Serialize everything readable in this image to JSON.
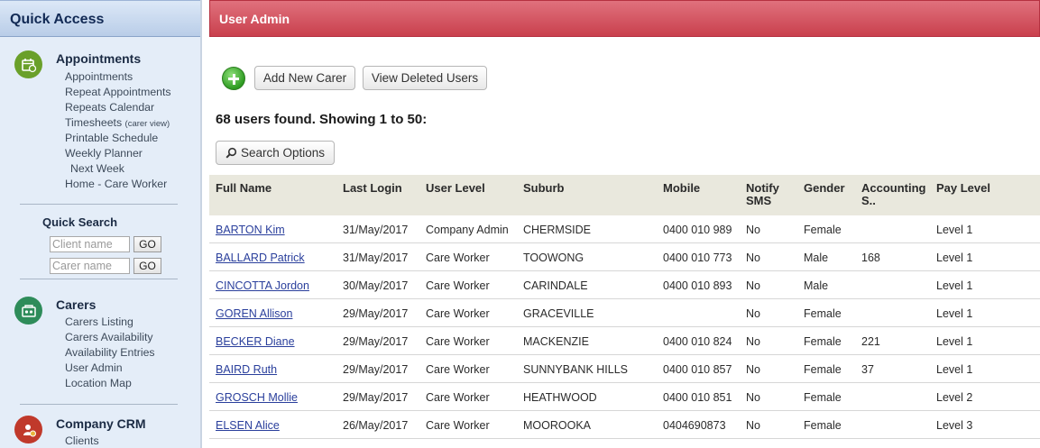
{
  "sidebar": {
    "title": "Quick Access",
    "sections": [
      {
        "title": "Appointments",
        "icon": "calendar-icon",
        "icon_color": "#6aa02a",
        "links": [
          "Appointments",
          "Repeat Appointments",
          "Repeats Calendar",
          "Timesheets",
          "Printable Schedule",
          "Weekly Planner",
          "Next Week",
          "Home - Care Worker"
        ],
        "timesheets_note": "(carer view)"
      },
      {
        "title": "Carers",
        "icon": "carers-icon",
        "icon_color": "#2e8c5a",
        "links": [
          "Carers Listing",
          "Carers Availability",
          "Availability Entries",
          "User Admin",
          "Location Map"
        ]
      },
      {
        "title": "Company CRM",
        "icon": "crm-icon",
        "icon_color": "#c0392b",
        "links": [
          "Clients"
        ]
      }
    ],
    "quick_search": {
      "title": "Quick Search",
      "client_placeholder": "Client name",
      "carer_placeholder": "Carer name",
      "go_label": "GO"
    }
  },
  "main": {
    "title": "User Admin",
    "header_color": "#cf4a57",
    "toolbar": {
      "add_icon": "plus-circle-icon",
      "add_carer_label": "Add New Carer",
      "view_deleted_label": "View Deleted Users",
      "search_options_label": "Search Options",
      "search_icon": "magnifier-icon"
    },
    "result_summary": "68 users found. Showing 1 to 50:",
    "table": {
      "columns": [
        "Full Name",
        "Last Login",
        "User Level",
        "Suburb",
        "Mobile",
        "Notify\nSMS",
        "Gender",
        "Accounting\nS..",
        "Pay Level"
      ],
      "rows": [
        [
          "BARTON Kim",
          "31/May/2017",
          "Company Admin",
          "CHERMSIDE",
          "0400 010 989",
          "No",
          "Female",
          "",
          "Level 1"
        ],
        [
          "BALLARD Patrick",
          "31/May/2017",
          "Care Worker",
          "TOOWONG",
          "0400 010 773",
          "No",
          "Male",
          "168",
          "Level 1"
        ],
        [
          "CINCOTTA Jordon",
          "30/May/2017",
          "Care Worker",
          "CARINDALE",
          "0400 010 893",
          "No",
          "Male",
          "",
          "Level 1"
        ],
        [
          "GOREN Allison",
          "29/May/2017",
          "Care Worker",
          "GRACEVILLE",
          "",
          "No",
          "Female",
          "",
          "Level 1"
        ],
        [
          "BECKER Diane",
          "29/May/2017",
          "Care Worker",
          "MACKENZIE",
          "0400 010 824",
          "No",
          "Female",
          "221",
          "Level 1"
        ],
        [
          "BAIRD Ruth",
          "29/May/2017",
          "Care Worker",
          "SUNNYBANK HILLS",
          "0400 010 857",
          "No",
          "Female",
          "37",
          "Level 1"
        ],
        [
          "GROSCH Mollie",
          "29/May/2017",
          "Care Worker",
          "HEATHWOOD",
          "0400 010 851",
          "No",
          "Female",
          "",
          "Level 2"
        ],
        [
          "ELSEN Alice",
          "26/May/2017",
          "Care Worker",
          "MOOROOKA",
          "0404690873",
          "No",
          "Female",
          "",
          "Level 3"
        ]
      ]
    }
  }
}
